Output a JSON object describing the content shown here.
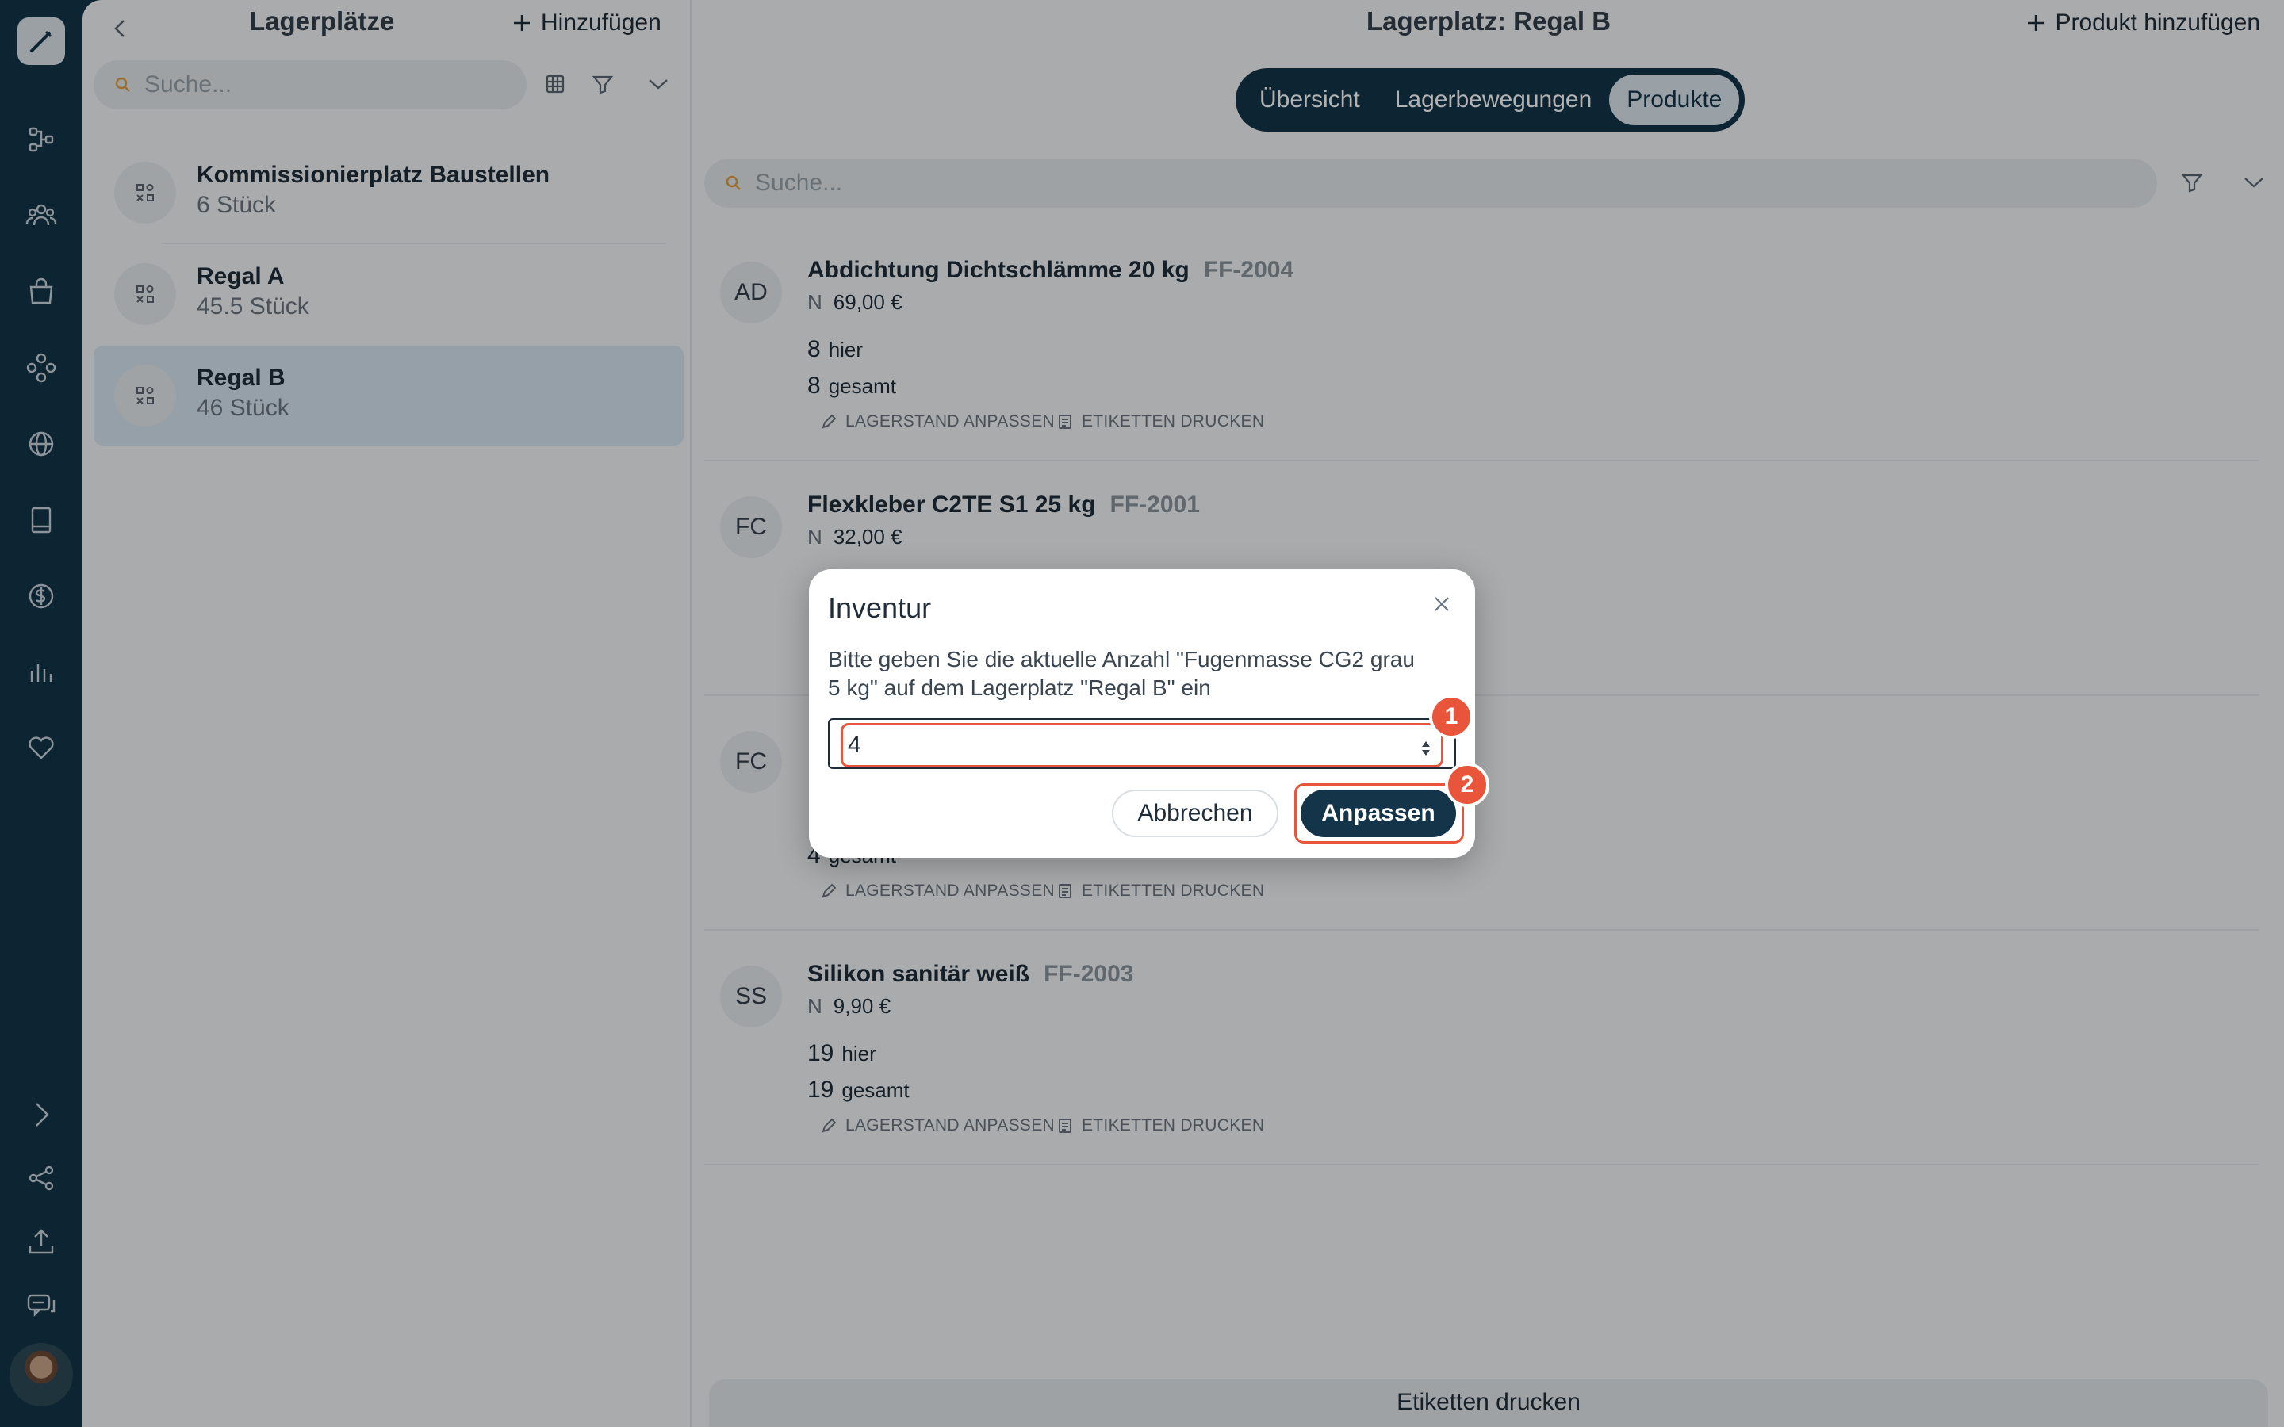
{
  "left_panel": {
    "title": "Lagerplätze",
    "add_label": "Hinzufügen",
    "search_placeholder": "Suche...",
    "items": [
      {
        "name": "Kommissionierplatz Baustellen",
        "count": "6 Stück"
      },
      {
        "name": "Regal A",
        "count": "45.5 Stück"
      },
      {
        "name": "Regal B",
        "count": "46 Stück"
      }
    ]
  },
  "right_panel": {
    "title": "Lagerplatz: Regal B",
    "add_product_label": "Produkt hinzufügen",
    "tabs": [
      "Übersicht",
      "Lagerbewegungen",
      "Produkte"
    ],
    "active_tab": "Produkte",
    "search_placeholder": "Suche...",
    "products": [
      {
        "initials": "AD",
        "name": "Abdichtung Dichtschlämme 20 kg",
        "sku": "FF-2004",
        "price_icon": "N",
        "price": "69,00 €",
        "here_qty": "8",
        "here_label": "hier",
        "total_qty": "8",
        "total_label": "gesamt"
      },
      {
        "initials": "FC",
        "name": "Flexkleber C2TE S1 25 kg",
        "sku": "FF-2001",
        "price_icon": "N",
        "price": "32,00 €"
      },
      {
        "initials": "FC",
        "total_qty": "4",
        "total_label": "gesamt"
      },
      {
        "initials": "SS",
        "name": "Silikon sanitär weiß",
        "sku": "FF-2003",
        "price_icon": "N",
        "price": "9,90 €",
        "here_qty": "19",
        "here_label": "hier",
        "total_qty": "19",
        "total_label": "gesamt"
      }
    ],
    "action_adjust": "LAGERSTAND ANPASSEN",
    "action_print": "ETIKETTEN DRUCKEN",
    "bottom_button": "Etiketten drucken"
  },
  "dialog": {
    "title": "Inventur",
    "text_line1": "Bitte geben Sie die aktuelle Anzahl \"Fugenmasse CG2 grau",
    "text_line2": "5 kg\" auf dem Lagerplatz \"Regal B\" ein",
    "input_value": "4",
    "cancel_label": "Abbrechen",
    "confirm_label": "Anpassen"
  },
  "badges": [
    "1",
    "2"
  ],
  "colors": {
    "sidebar": "#143549",
    "selected_item": "#d7e5f2",
    "highlight": "#e8553a"
  }
}
